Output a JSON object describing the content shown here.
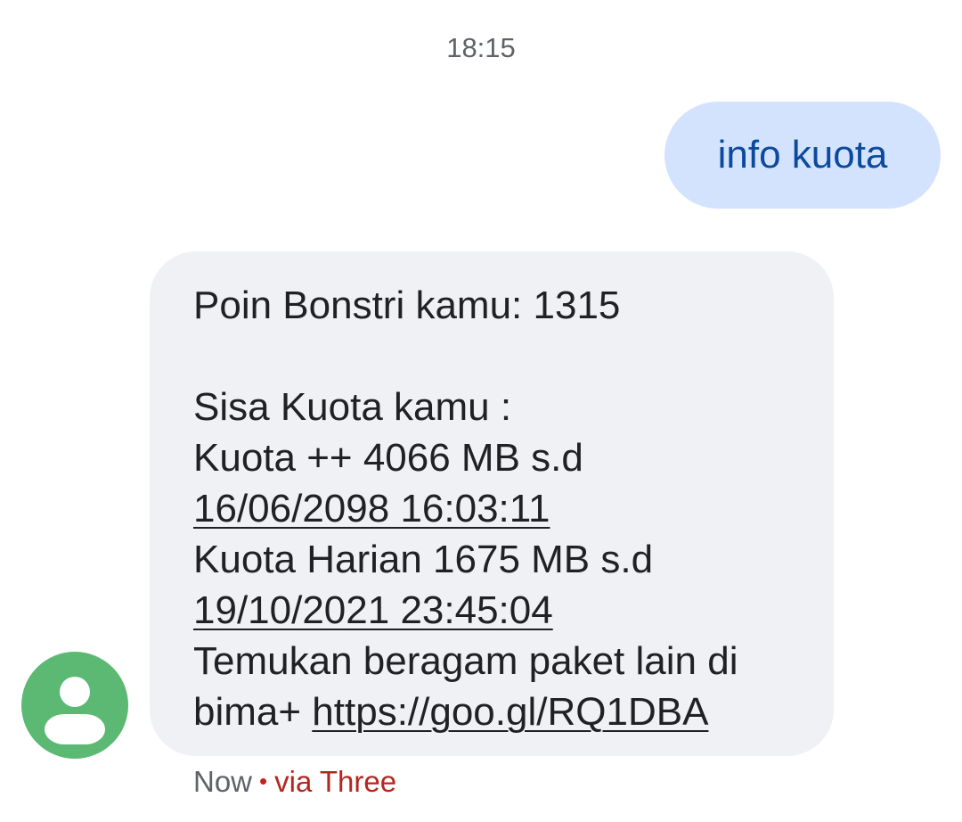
{
  "conversation": {
    "timestamp": "18:15",
    "sent_message": {
      "text": "info kuota"
    },
    "received_message": {
      "line1": "Poin Bonstri kamu: 1315",
      "line2": "Sisa Kuota kamu :",
      "line3": "Kuota ++ 4066 MB s.d",
      "line4_date": "16/06/2098 16:03:11",
      "line5": "Kuota Harian 1675 MB s.d",
      "line6_date": "19/10/2021 23:45:04",
      "line7": "Temukan beragam paket lain di",
      "line8_prefix": "bima+ ",
      "line8_link": "https://goo.gl/RQ1DBA"
    },
    "meta": {
      "status": "Now",
      "separator": "•",
      "via": "via Three"
    },
    "avatar_icon": "person-icon"
  },
  "colors": {
    "sent_bubble": "#d3e3fd",
    "sent_text": "#0b4a9e",
    "received_bubble": "#f0f1f4",
    "avatar": "#5bb974",
    "via_text": "#b3261e"
  }
}
